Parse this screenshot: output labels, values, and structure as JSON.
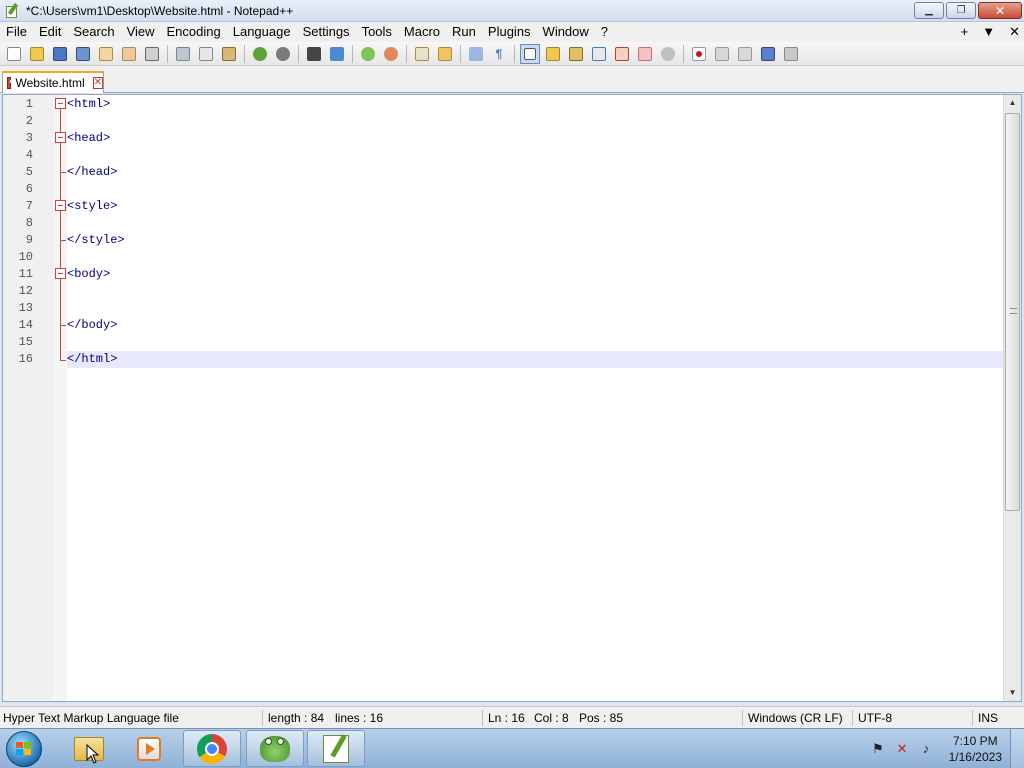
{
  "window": {
    "title": "*C:\\Users\\vm1\\Desktop\\Website.html - Notepad++",
    "controls": {
      "minimize": "▁",
      "maximize": "❐",
      "close": "✕"
    }
  },
  "menu": {
    "items": [
      "File",
      "Edit",
      "Search",
      "View",
      "Encoding",
      "Language",
      "Settings",
      "Tools",
      "Macro",
      "Run",
      "Plugins",
      "Window",
      "?"
    ],
    "right": {
      "add": "+",
      "dropdown": "▼",
      "close": "✕"
    }
  },
  "toolbar": {
    "icons": [
      "new-file-icon",
      "open-file-icon",
      "save-icon",
      "save-all-icon",
      "close-icon",
      "close-all-icon",
      "print-icon",
      "cut-icon",
      "copy-icon",
      "paste-icon",
      "undo-icon",
      "redo-icon",
      "find-icon",
      "replace-icon",
      "zoom-in-icon",
      "zoom-out-icon",
      "sync-v-icon",
      "sync-h-icon",
      "wrap-icon",
      "show-all-chars-icon",
      "indent-guide-icon",
      "udl-icon",
      "doc-map-icon",
      "doc-list-icon",
      "function-list-icon",
      "folder-workspace-icon",
      "monitor-icon",
      "record-macro-icon",
      "stop-macro-icon",
      "play-macro-icon",
      "run-macro-multiple-icon",
      "save-macro-icon"
    ]
  },
  "tabs": [
    {
      "label": "Website.html",
      "close": "✕",
      "active": true
    }
  ],
  "editor": {
    "lines": [
      {
        "num": "1",
        "text": "<html>"
      },
      {
        "num": "2",
        "text": ""
      },
      {
        "num": "3",
        "text": "<head>"
      },
      {
        "num": "4",
        "text": ""
      },
      {
        "num": "5",
        "text": "</head>"
      },
      {
        "num": "6",
        "text": ""
      },
      {
        "num": "7",
        "text": "<style>"
      },
      {
        "num": "8",
        "text": ""
      },
      {
        "num": "9",
        "text": "</style>"
      },
      {
        "num": "10",
        "text": ""
      },
      {
        "num": "11",
        "text": "<body>"
      },
      {
        "num": "12",
        "text": ""
      },
      {
        "num": "13",
        "text": ""
      },
      {
        "num": "14",
        "text": "</body>"
      },
      {
        "num": "15",
        "text": ""
      },
      {
        "num": "16",
        "text": "</html>"
      }
    ],
    "current_line": "16"
  },
  "status": {
    "file_type": "Hyper Text Markup Language file",
    "length": "length : 84",
    "lines": "lines : 16",
    "ln": "Ln : 16",
    "col": "Col : 8",
    "pos": "Pos : 85",
    "eol": "Windows (CR LF)",
    "encoding": "UTF-8",
    "mode": "INS"
  },
  "taskbar": {
    "apps": [
      {
        "name": "explorer",
        "state": "pinned"
      },
      {
        "name": "media-player",
        "state": "pinned"
      },
      {
        "name": "chrome",
        "state": "open"
      },
      {
        "name": "frog-app",
        "state": "open"
      },
      {
        "name": "notepad-plus-plus",
        "state": "open"
      }
    ],
    "clock": {
      "time": "7:10 PM",
      "date": "1/16/2023"
    }
  },
  "colors": {
    "accent_tab": "#f6a624",
    "code_text": "#000080",
    "fold_marker": "#d04040",
    "current_line_bg": "#e8e8ff"
  }
}
